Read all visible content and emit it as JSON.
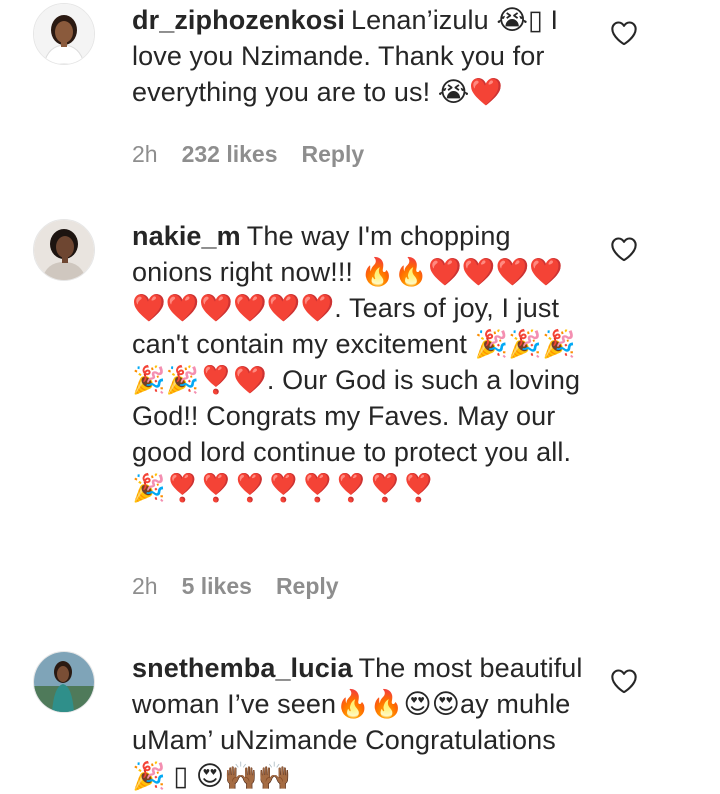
{
  "comments": [
    {
      "username": "dr_ziphozenkosi",
      "text": "Lenan’izulu 😭▯ I love you Nzimande. Thank you for everything you are to us! 😭❤️",
      "time": "2h",
      "likes": "232 likes",
      "reply": "Reply",
      "avatar": "avatar-woman-white-top"
    },
    {
      "username": "nakie_m",
      "text": "The way I'm chopping onions right now!!! 🔥🔥❤️❤️❤️❤️❤️❤️❤️❤️❤️❤️. Tears of joy, I just can't contain my excitement 🎉🎉🎉🎉🎉❣️❤️. Our God is such a loving God!! Congrats my Faves. May our good lord continue to protect you all. 🎉❣️❣️❣️❣️❣️❣️❣️❣️",
      "time": "2h",
      "likes": "5 likes",
      "reply": "Reply",
      "avatar": "avatar-woman-smiling"
    },
    {
      "username": "snethemba_lucia",
      "text": "The most beautiful woman I’ve seen🔥🔥😍😍ay muhle uMam’ uNzimande Congratulations 🎉 ▯ 😍🙌🏾🙌🏾",
      "time": "",
      "likes": "",
      "reply": "",
      "avatar": "avatar-woman-outdoors"
    }
  ],
  "icons": {
    "like": "heart-outline-icon"
  },
  "colors": {
    "text": "#262626",
    "meta": "#8e8e8e"
  }
}
